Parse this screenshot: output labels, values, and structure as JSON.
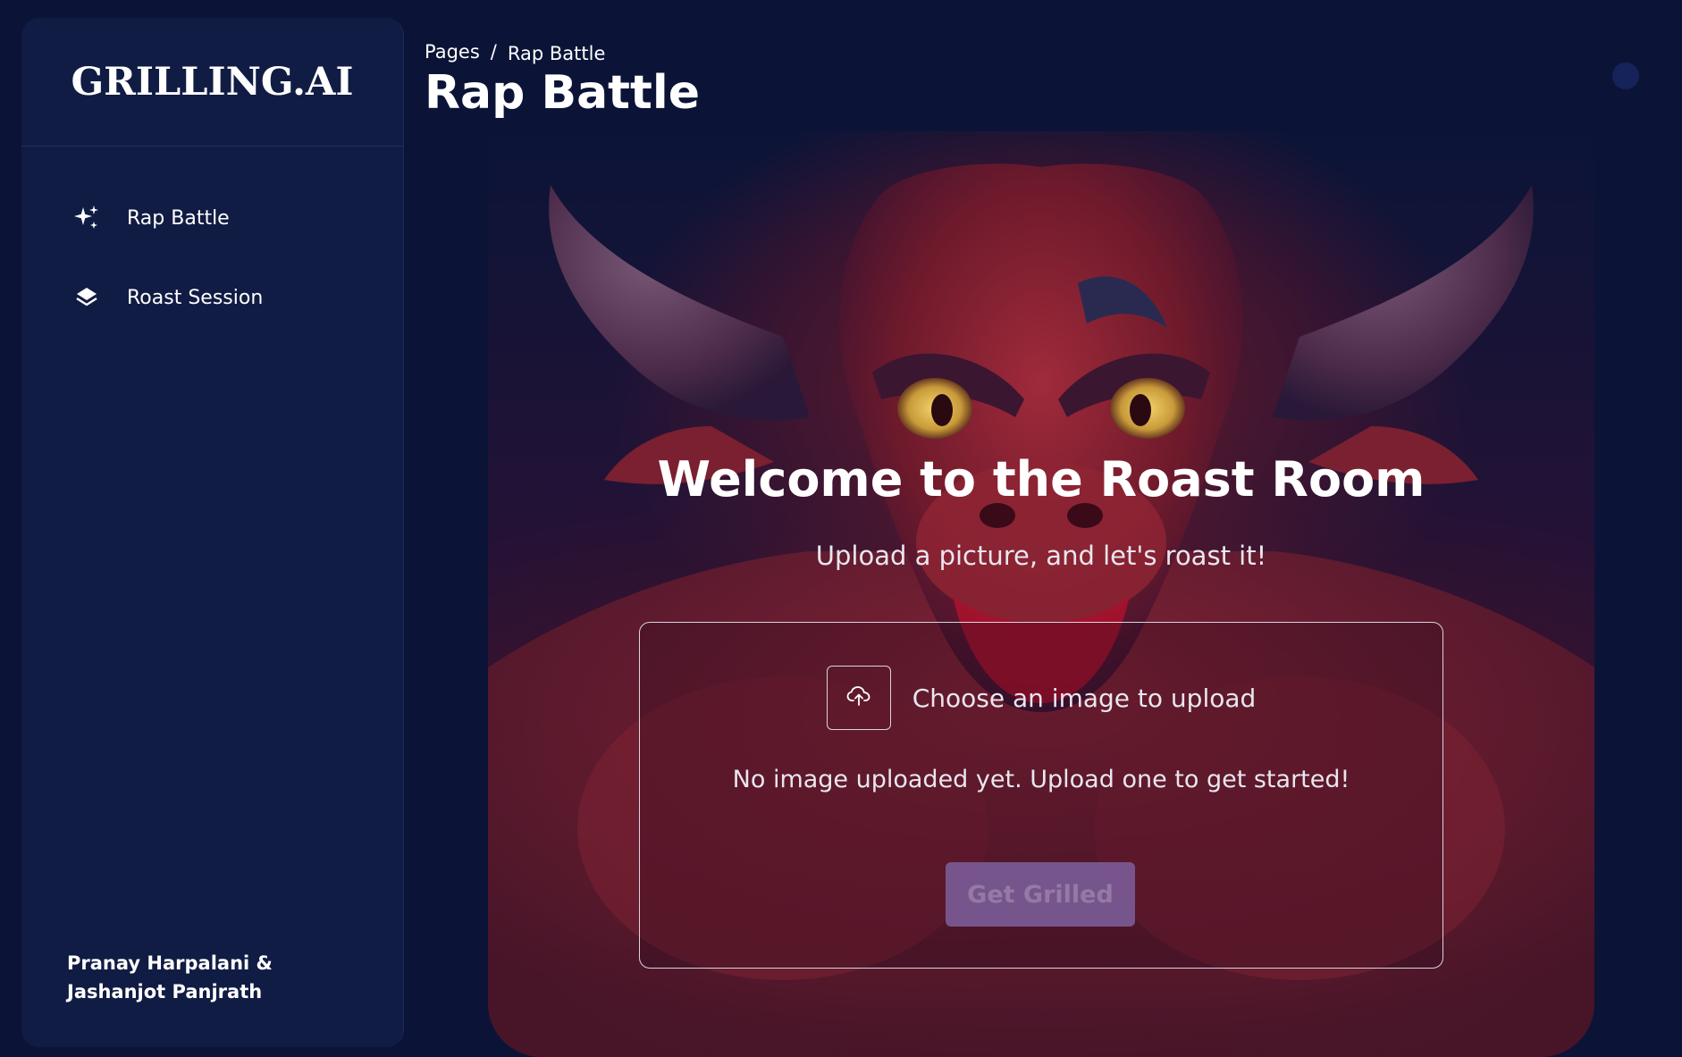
{
  "brand": {
    "name": "GRILLING.AI"
  },
  "sidebar": {
    "items": [
      {
        "label": "Rap Battle",
        "icon": "sparkles-icon"
      },
      {
        "label": "Roast Session",
        "icon": "layers-icon"
      }
    ],
    "credits": "Pranay Harpalani & Jashanjot Panjrath"
  },
  "header": {
    "breadcrumb_root": "Pages",
    "breadcrumb_separator": "/",
    "breadcrumb_current": "Rap Battle",
    "title": "Rap Battle"
  },
  "hero": {
    "heading": "Welcome to the Roast Room",
    "subheading": "Upload a picture, and let's roast it!",
    "image": "red-bull-mascot"
  },
  "upload": {
    "icon": "cloud-upload-icon",
    "label": "Choose an image to upload",
    "empty_message": "No image uploaded yet. Upload one to get started!",
    "submit_label": "Get Grilled",
    "submit_disabled": true
  },
  "colors": {
    "background": "#0b1437",
    "sidebar": "#111c44",
    "button_disabled": "#7a5b95",
    "mascot_red": "#8a1f2c"
  }
}
